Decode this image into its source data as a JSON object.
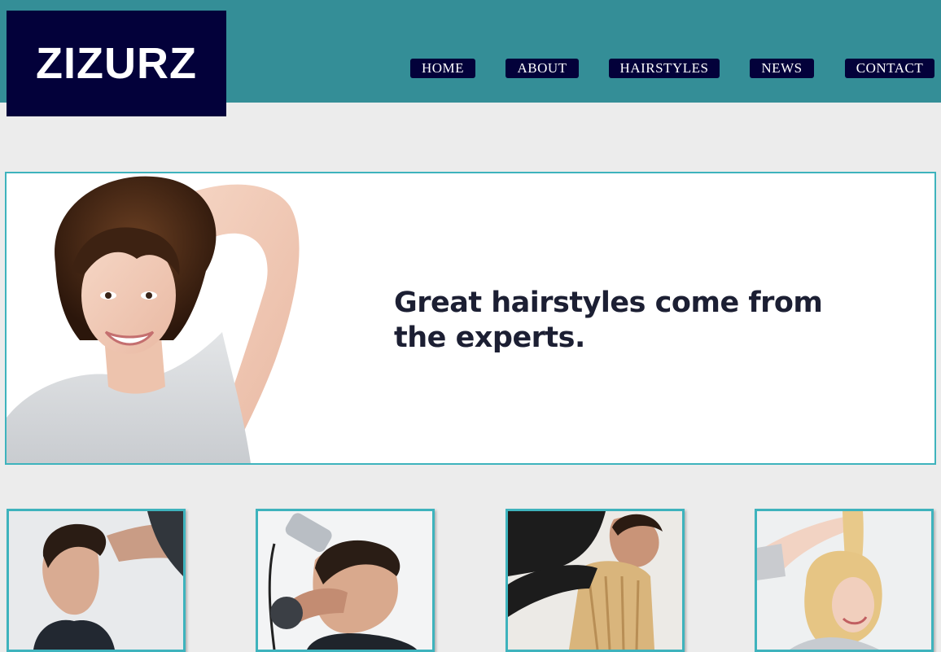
{
  "brand": {
    "logo_text": "ZIZURZ"
  },
  "nav": {
    "items": [
      "HOME",
      "ABOUT",
      "HAIRSTYLES",
      "NEWS",
      "CONTACT"
    ]
  },
  "hero": {
    "headline": "Great hairstyles come from the experts."
  },
  "colors": {
    "header_bg": "#348e97",
    "nav_bg": "#03013a",
    "accent_border": "#3eb3bd",
    "page_bg": "#ececec"
  },
  "gallery": {
    "items": [
      "man-haircut-photo",
      "clipper-haircut-photo",
      "stylist-cutting-blonde-hair-photo",
      "woman-hair-length-photo"
    ]
  }
}
